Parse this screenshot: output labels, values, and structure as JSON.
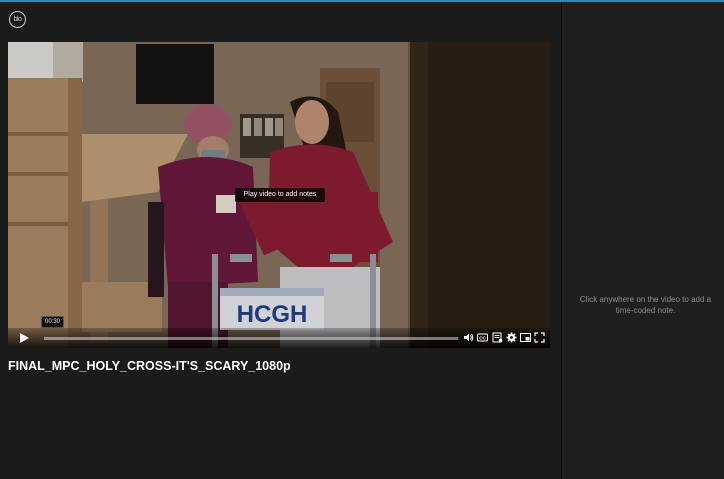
{
  "app": {
    "logo_text": "blo"
  },
  "player": {
    "center_hint": "Play video to add notes",
    "timestamp": "00:30",
    "progress": 0.0,
    "icons": [
      "play-icon",
      "volume-icon",
      "captions-icon",
      "transcript-icon",
      "settings-icon",
      "picture-in-picture-icon",
      "fullscreen-icon"
    ]
  },
  "video": {
    "title": "FINAL_MPC_HOLY_CROSS-IT'S_SCARY_1080p",
    "walker_logo": "HCGH"
  },
  "sidebar": {
    "hint": "Click anywhere on the video to add a time-coded note."
  },
  "colors": {
    "accent": "#1a8cd8",
    "background": "#1b1b1b",
    "sidebar": "#1f1f1f"
  }
}
